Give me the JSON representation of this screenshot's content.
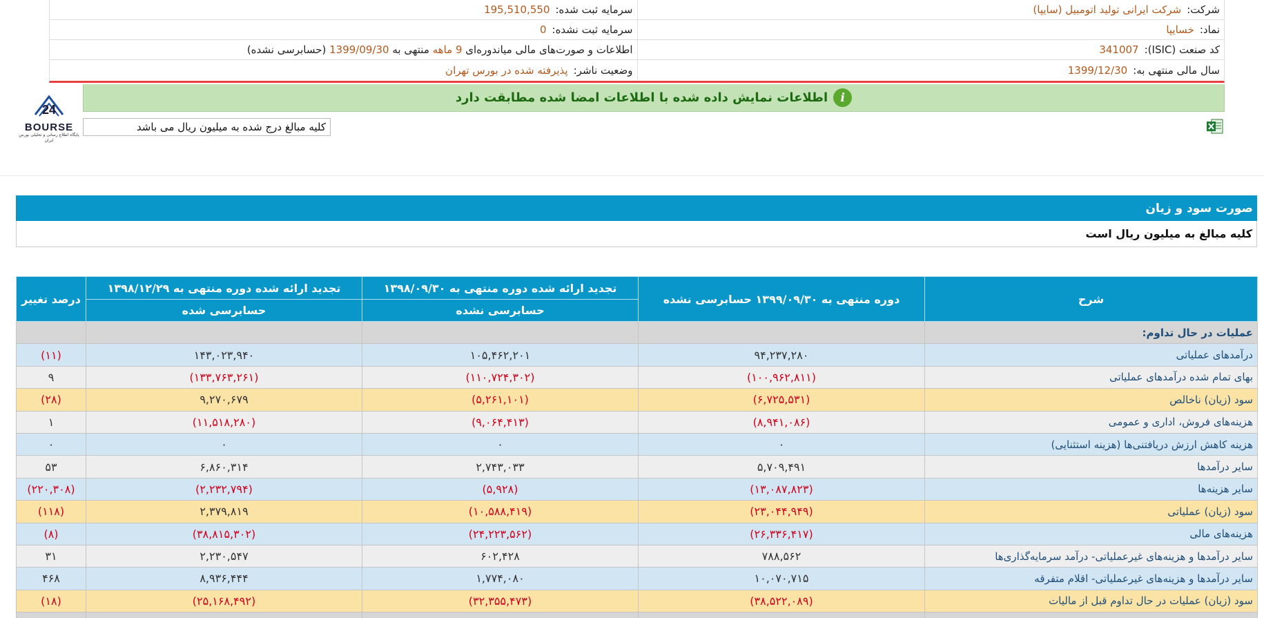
{
  "header": {
    "company_label": "شرکت:",
    "company_value": "شرکت ایرانی تولید اتومبیل (سایپا)",
    "registered_capital_label": "سرمایه ثبت شده:",
    "registered_capital_value": "195,510,550",
    "symbol_label": "نماد:",
    "symbol_value": "خسایپا",
    "unregistered_capital_label": "سرمایه ثبت نشده:",
    "unregistered_capital_value": "0",
    "isic_label": "کد صنعت (ISIC):",
    "isic_value": "341007",
    "report_text_1": "اطلاعات و صورت‌های مالی میاندوره‌ای",
    "report_period": "9 ماهه",
    "report_text_2": "منتهی به",
    "report_date": "1399/09/30",
    "report_text_3": "(حسابرسی نشده)",
    "fiscal_year_label": "سال مالی منتهی به:",
    "fiscal_year_value": "1399/12/30",
    "publisher_status_label": "وضعیت ناشر:",
    "publisher_status_value": "پذیرفته شده در بورس تهران"
  },
  "verification": {
    "icon": "info-icon",
    "text": "اطلاعات نمایش داده شده با اطلاعات امضا شده مطابقت دارد"
  },
  "logo": {
    "word": "BOURSE",
    "number": "24",
    "subtitle": "پایگاه اطلاع رسانی و تحلیلی بورس ایران"
  },
  "units_note": "کلیه مبالغ درج شده به میلیون ریال می باشد",
  "excel_icon": "excel-export-icon",
  "section": {
    "title": "صورت سود و زیان",
    "note": "کلیه مبالغ به میلیون ریال است"
  },
  "colors": {
    "header_blue": "#0897c8",
    "negative_red": "#d0021b",
    "highlight_row": "#fbe3a6",
    "banner_green": "#c3e3b6"
  },
  "table": {
    "headers": {
      "desc": "شرح",
      "col1": "دوره منتهی به ۱۳۹۹/۰۹/۳۰ حسابرسی نشده",
      "col2_top": "تجدید ارائه شده دوره منتهی به ۱۳۹۸/۰۹/۳۰",
      "col2_bottom": "حسابرسی نشده",
      "col3_top": "تجدید ارائه شده دوره منتهی به ۱۳۹۸/۱۲/۲۹",
      "col3_bottom": "حسابرسی شده",
      "pct": "درصد تغییر"
    },
    "group_title": "عملیات در حال تداوم:",
    "rows": [
      {
        "desc": "درآمدهای عملیاتی",
        "c1": "۹۴,۲۳۷,۲۸۰",
        "c2": "۱۰۵,۴۶۲,۲۰۱",
        "c3": "۱۴۳,۰۲۳,۹۴۰",
        "pct": "(۱۱)"
      },
      {
        "desc": "بهای تمام شده درآمدهای عملیاتی",
        "c1": "(۱۰۰,۹۶۲,۸۱۱)",
        "c2": "(۱۱۰,۷۲۴,۳۰۲)",
        "c3": "(۱۳۳,۷۶۳,۲۶۱)",
        "pct": "۹"
      },
      {
        "desc": "سود (زیان) ناخالص",
        "c1": "(۶,۷۲۵,۵۳۱)",
        "c2": "(۵,۲۶۱,۱۰۱)",
        "c3": "۹,۲۷۰,۶۷۹",
        "pct": "(۲۸)"
      },
      {
        "desc": "هزینه‌های فروش، اداری و عمومی",
        "c1": "(۸,۹۴۱,۰۸۶)",
        "c2": "(۹,۰۶۴,۴۱۳)",
        "c3": "(۱۱,۵۱۸,۲۸۰)",
        "pct": "۱"
      },
      {
        "desc": "هزینه کاهش ارزش دریافتنی‌ها (هزینه استثنایی)",
        "c1": "۰",
        "c2": "۰",
        "c3": "۰",
        "pct": "۰"
      },
      {
        "desc": "سایر درآمدها",
        "c1": "۵,۷۰۹,۴۹۱",
        "c2": "۲,۷۴۳,۰۳۳",
        "c3": "۶,۸۶۰,۳۱۴",
        "pct": "۵۳"
      },
      {
        "desc": "سایر هزینه‌ها",
        "c1": "(۱۳,۰۸۷,۸۲۳)",
        "c2": "(۵,۹۲۸)",
        "c3": "(۲,۲۳۲,۷۹۴)",
        "pct": "(۲۲۰,۳۰۸)"
      },
      {
        "desc": "سود (زیان) عملیاتی",
        "c1": "(۲۳,۰۴۴,۹۴۹)",
        "c2": "(۱۰,۵۸۸,۴۱۹)",
        "c3": "۲,۳۷۹,۸۱۹",
        "pct": "(۱۱۸)"
      },
      {
        "desc": "هزینه‌های مالی",
        "c1": "(۲۶,۳۳۶,۴۱۷)",
        "c2": "(۲۴,۲۲۳,۵۶۲)",
        "c3": "(۳۸,۸۱۵,۳۰۲)",
        "pct": "(۸)"
      },
      {
        "desc": "سایر درآمدها و هزینه‌های غیرعملیاتی- درآمد سرمایه‌گذاری‌ها",
        "c1": "۷۸۸,۵۶۲",
        "c2": "۶۰۲,۴۲۸",
        "c3": "۲,۲۳۰,۵۴۷",
        "pct": "۳۱"
      },
      {
        "desc": "سایر درآمدها و هزینه‌های غیرعملیاتی- اقلام متفرقه",
        "c1": "۱۰,۰۷۰,۷۱۵",
        "c2": "۱,۷۷۴,۰۸۰",
        "c3": "۸,۹۳۶,۴۴۴",
        "pct": "۴۶۸"
      },
      {
        "desc": "سود (زیان) عملیات در حال تداوم قبل از مالیات",
        "c1": "(۳۸,۵۲۲,۰۸۹)",
        "c2": "(۳۲,۳۵۵,۴۷۳)",
        "c3": "(۲۵,۱۶۸,۴۹۲)",
        "pct": "(۱۸)"
      }
    ]
  }
}
